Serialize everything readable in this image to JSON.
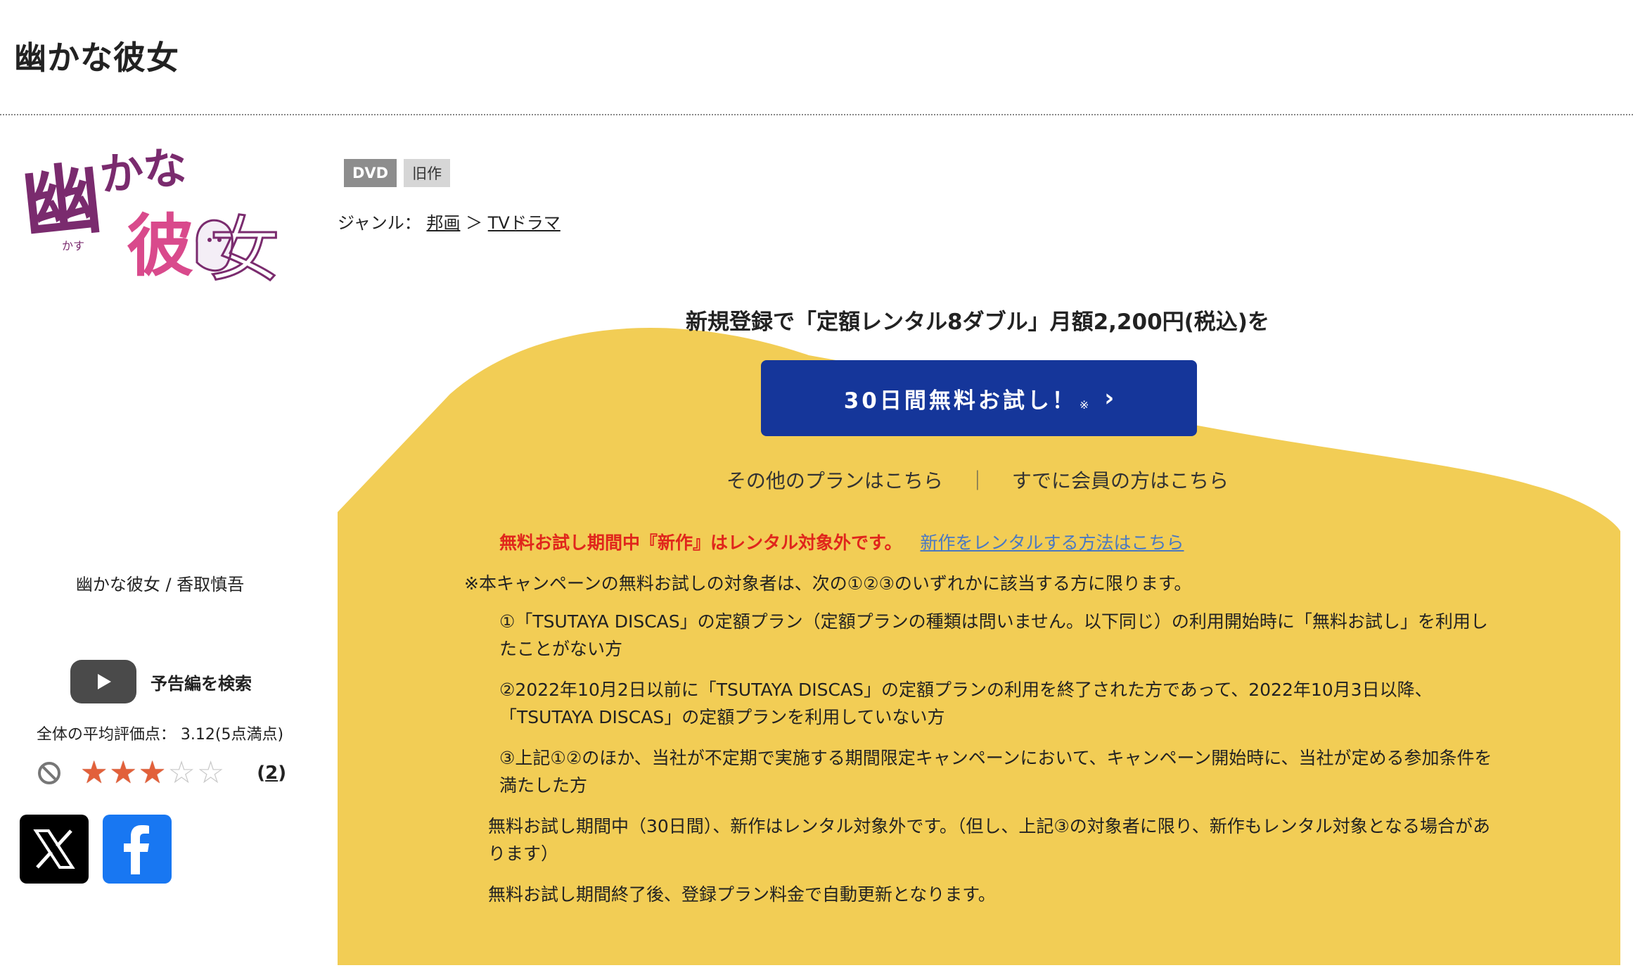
{
  "header": {
    "title": "幽かな彼女"
  },
  "logo": {
    "char1": "幽",
    "kana": "かな",
    "char2": "彼",
    "char3": "女",
    "ruby": "かす",
    "text_color": "#7a2b6e",
    "accent_color": "#d94a8c"
  },
  "tags": {
    "dvd": "DVD",
    "old": "旧作"
  },
  "genre": {
    "label": "ジャンル：",
    "items": [
      "邦画",
      "TVドラマ"
    ],
    "separator": "＞"
  },
  "caption": "幽かな彼女 / 香取慎吾",
  "trailer": {
    "icon": "youtube-play-icon",
    "label": "予告編を検索"
  },
  "rating": {
    "average_text": "全体の平均評価点： 3.12(5点満点)",
    "value": 3,
    "max": 5,
    "review_count_open": "(",
    "review_count": "2",
    "review_count_close": ")"
  },
  "social": [
    {
      "name": "x-share-icon",
      "color": "#000000"
    },
    {
      "name": "facebook-share-icon",
      "color": "#1877f2"
    }
  ],
  "promo": {
    "headline": "新規登録で「定額レンタル8ダブル」月額2,200円(税込)を",
    "cta_label": "30日間無料お試し！",
    "cta_note": "※",
    "other_plans": "その他のプランはこちら",
    "separator": "｜",
    "members": "すでに会員の方はこちら",
    "warning": "無料お試し期間中『新作』はレンタル対象外です。",
    "warning_link": "新作をレンタルする方法はこちら",
    "terms_intro": "※本キャンペーンの無料お試しの対象者は、次の①②③のいずれかに該当する方に限ります。",
    "terms_items": [
      "①「TSUTAYA DISCAS」の定額プラン（定額プランの種類は問いません。以下同じ）の利用開始時に「無料お試し」を利用したことがない方",
      "②2022年10月2日以前に「TSUTAYA DISCAS」の定額プランの利用を終了された方であって、2022年10月3日以降、「TSUTAYA DISCAS」の定額プランを利用していない方",
      "③上記①②のほか、当社が不定期で実施する期間限定キャンペーンにおいて、キャンペーン開始時に、当社が定める参加条件を満たした方"
    ],
    "terms_note1": "無料お試し期間中（30日間）、新作はレンタル対象外です。（但し、上記③の対象者に限り、新作もレンタル対象となる場合があります）",
    "terms_note2": "無料お試し期間終了後、登録プラン料金で自動更新となります。",
    "bg_color": "#f2cd55",
    "button_color": "#15369a",
    "warning_color": "#e0261c"
  }
}
